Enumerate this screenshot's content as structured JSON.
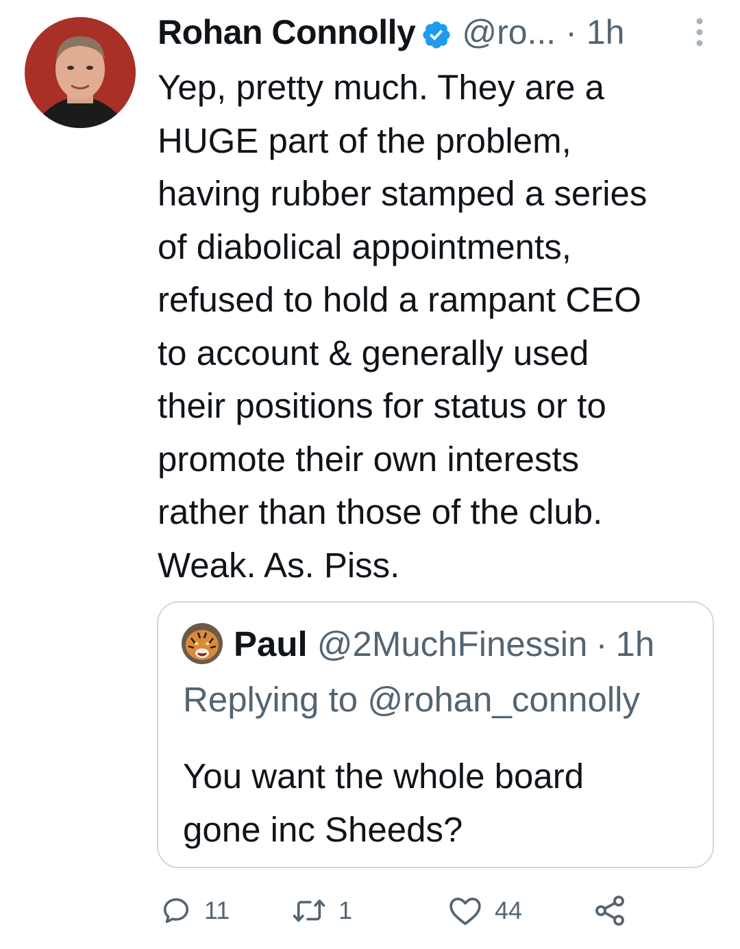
{
  "tweet": {
    "author": {
      "display_name": "Rohan Connolly",
      "handle": "@ro...",
      "verified": true,
      "avatar_icon": "user-avatar-photo"
    },
    "time": "1h",
    "separator": "·",
    "text_lines": [
      "Yep, pretty much. They are a",
      "HUGE part of the problem,",
      "having rubber stamped a series",
      "of diabolical appointments,",
      "refused to hold a rampant CEO",
      "to account & generally used",
      "their positions for status or to",
      "promote their own interests",
      "rather than those of the club.",
      "Weak. As. Piss."
    ],
    "more_icon": "more-vertical-icon"
  },
  "quoted_tweet": {
    "author": {
      "display_name": "Paul",
      "handle": "@2MuchFinessin",
      "avatar_icon": "tiger-avatar"
    },
    "time": "1h",
    "separator": "·",
    "replying_to": "Replying to @rohan_connolly",
    "text_lines": [
      "You want the whole board",
      "gone inc Sheeds?"
    ]
  },
  "actions": {
    "reply": {
      "icon": "reply-icon",
      "count": "11"
    },
    "retweet": {
      "icon": "retweet-icon",
      "count": "1"
    },
    "like": {
      "icon": "heart-icon",
      "count": "44"
    },
    "share": {
      "icon": "share-icon"
    }
  },
  "colors": {
    "text": "#0f1419",
    "secondary": "#536471",
    "verified_blue": "#1d9bf0",
    "border": "#cfd9de"
  }
}
